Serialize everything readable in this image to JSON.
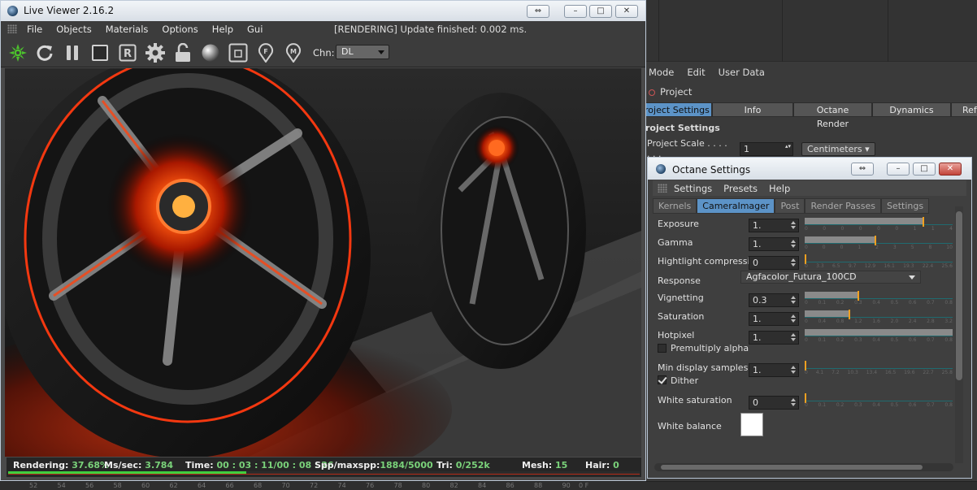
{
  "colors": {
    "accent": "#5c93c7",
    "progress": "#3fcf3f",
    "slider_handle": "#f0a020",
    "status_value": "#7ad27a"
  },
  "live_viewer": {
    "title": "Live Viewer 2.16.2",
    "menu": [
      "File",
      "Objects",
      "Materials",
      "Options",
      "Help",
      "Gui"
    ],
    "status": "[RENDERING] Update finished: 0.002 ms.",
    "toolbar_icons": [
      "octane-logo-icon",
      "refresh-icon",
      "pause-icon",
      "stop-icon",
      "r-icon",
      "gear-icon",
      "lock-icon",
      "sphere-icon",
      "region-icon",
      "focus-pick-icon",
      "material-pick-icon"
    ],
    "toolbar_letters": {
      "r": "R",
      "f": "F",
      "m": "M"
    },
    "channel_label": "Chn:",
    "channel_value": "DL",
    "statusbar": {
      "rendering_label": "Rendering:",
      "rendering_value": "37.68%",
      "ms_label": "Ms/sec:",
      "ms_value": "3.784",
      "time_label": "Time:",
      "time_value": "00 : 03 : 11/00 : 08 : 26",
      "spp_label": "Spp/maxspp:",
      "spp_value": "1884/5000",
      "tri_label": "Tri:",
      "tri_value": "0/252k",
      "mesh_label": "Mesh:",
      "mesh_value": "15",
      "hair_label": "Hair:",
      "hair_value": "0",
      "progress": 0.3768
    }
  },
  "background_panel": {
    "menu": [
      "Mode",
      "Edit",
      "User Data"
    ],
    "project_label": "Project",
    "tabs": [
      "roject Settings",
      "Info",
      "Octane Render",
      "Dynamics",
      "Ref"
    ],
    "section_title": "roject Settings",
    "scale_label": "Project Scale . . . . . . .",
    "scale_value": "1",
    "scale_unit": "Centimeters",
    "ruler_labels": [
      "52",
      "54",
      "56",
      "58",
      "60",
      "62",
      "64",
      "66",
      "68",
      "70",
      "72",
      "74",
      "76",
      "78",
      "80",
      "82",
      "84",
      "86",
      "88",
      "90",
      "0 F"
    ]
  },
  "octane_settings": {
    "title": "Octane Settings",
    "menu": [
      "Settings",
      "Presets",
      "Help"
    ],
    "tabs": [
      "Kernels",
      "CameraImager",
      "Post",
      "Render Passes",
      "Settings"
    ],
    "active_tab": "CameraImager",
    "exposure": {
      "label": "Exposure",
      "value": "1.",
      "level": 0.8,
      "ticks": [
        "0",
        "0",
        "0",
        "0",
        "0",
        "0",
        "1",
        "1",
        "4"
      ]
    },
    "gamma": {
      "label": "Gamma",
      "value": "1.",
      "level": 0.48,
      "ticks": [
        "0",
        "0",
        "0",
        "1",
        "2",
        "3",
        "5",
        "8",
        "10"
      ]
    },
    "highlight": {
      "label": "Hightlight compressi",
      "value": "0",
      "level": 0.0,
      "ticks": [
        "0",
        "3.3",
        "6.5",
        "9.7",
        "12.9",
        "16.1",
        "19.3",
        "22.4",
        "25.6"
      ]
    },
    "response": {
      "label": "Response",
      "value": "Agfacolor_Futura_100CD"
    },
    "vignetting": {
      "label": "Vignetting",
      "value": "0.3",
      "level": 0.36,
      "ticks": [
        "0",
        "0.1",
        "0.2",
        "0.3",
        "0.4",
        "0.5",
        "0.6",
        "0.7",
        "0.8"
      ]
    },
    "saturation": {
      "label": "Saturation",
      "value": "1.",
      "level": 0.3,
      "ticks": [
        "0",
        "0.4",
        "0.8",
        "1.2",
        "1.6",
        "2.0",
        "2.4",
        "2.8",
        "3.2"
      ]
    },
    "hotpixel": {
      "label": "Hotpixel",
      "value": "1.",
      "level": 1.0,
      "ticks": [
        "0",
        "0.1",
        "0.2",
        "0.3",
        "0.4",
        "0.5",
        "0.6",
        "0.7",
        "0.8"
      ]
    },
    "premultiply_label": "Premultiply alpha",
    "min_display": {
      "label": "Min display samples",
      "value": "1.",
      "level": 0.0,
      "ticks": [
        "0",
        "4.1",
        "7.2",
        "10.3",
        "13.4",
        "16.5",
        "19.6",
        "22.7",
        "25.8"
      ]
    },
    "dither_label": "Dither",
    "white_saturation": {
      "label": "White saturation",
      "value": "0",
      "level": 0.0,
      "ticks": [
        "0",
        "0.1",
        "0.2",
        "0.3",
        "0.4",
        "0.5",
        "0.6",
        "0.7",
        "0.8"
      ]
    },
    "white_balance_label": "White balance",
    "white_balance_color": "#ffffff"
  }
}
